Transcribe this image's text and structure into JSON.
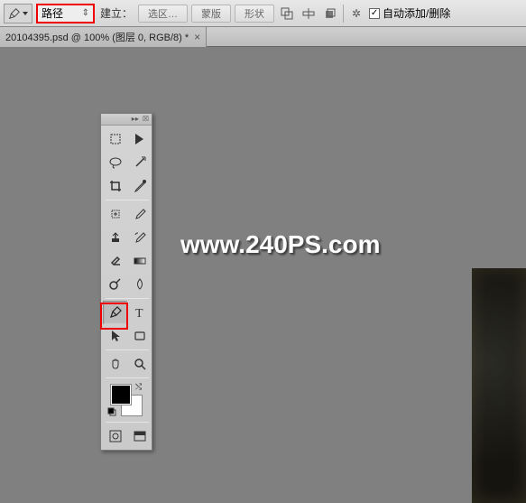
{
  "optionsBar": {
    "modeDropdown": "路径",
    "makeLabel": "建立：",
    "makeSelection": "选区…",
    "makeMask": "蒙版",
    "makeShape": "形状",
    "autoAddDelete": "自动添加/删除",
    "autoChecked": "✓"
  },
  "docTab": {
    "title": "20104395.psd @ 100% (图层 0, RGB/8) *"
  },
  "watermark": "www.240PS.com",
  "tools": {
    "header": {
      "collapse": "▸▸",
      "close": "☒"
    }
  }
}
